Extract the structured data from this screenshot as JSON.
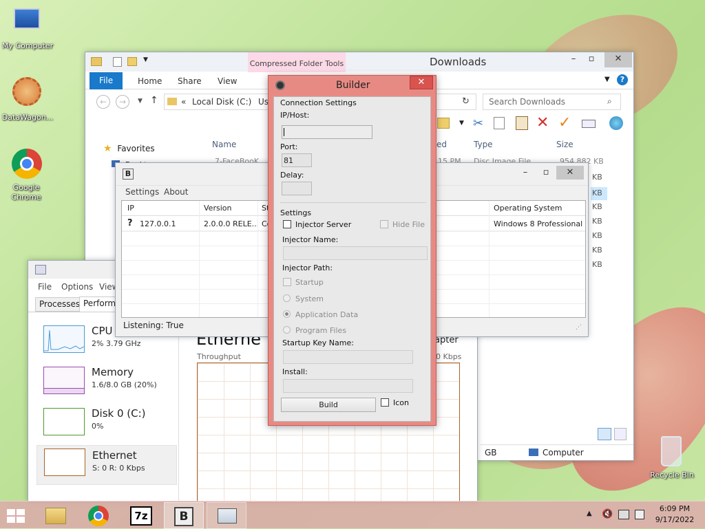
{
  "desktop": {
    "icons": [
      {
        "label": "My Computer"
      },
      {
        "label": "DataWagon..."
      },
      {
        "label": "Google Chrome"
      },
      {
        "label": "Recycle Bin"
      }
    ]
  },
  "explorer": {
    "title": "Downloads",
    "context_tab": "Compressed Folder Tools",
    "ribbon_tabs": [
      "File",
      "Home",
      "Share",
      "View"
    ],
    "address_prefix": "«",
    "address": "Local Disk (C:)",
    "address_tail": "Us",
    "search_placeholder": "Search Downloads",
    "nav": {
      "favorites": "Favorites",
      "desktop": "Desktop"
    },
    "columns": {
      "name": "Name",
      "date_partial": "ed",
      "type": "Type",
      "size": "Size"
    },
    "row_first": {
      "name_partial": "7-FaceBooK",
      "date_partial": "15 PM",
      "type": "Disc Image File",
      "size": "954,882 KB"
    },
    "size_unit": "KB",
    "status_size": "GB",
    "status_location": "Computer"
  },
  "client": {
    "icon_letter": "B",
    "menu": [
      "Settings",
      "About"
    ],
    "columns": [
      "IP",
      "Version",
      "St",
      "Operating System"
    ],
    "rows": [
      {
        "ip": "127.0.0.1",
        "version": "2.0.0.0 RELE...",
        "status": "Co",
        "os": "Windows 8 Professional 6"
      }
    ],
    "status": "Listening: True"
  },
  "taskmgr": {
    "menu": [
      "File",
      "Options",
      "View"
    ],
    "tabs": [
      "Processes",
      "Performa"
    ],
    "items": [
      {
        "name": "CPU",
        "value": "2% 3.79 GHz"
      },
      {
        "name": "Memory",
        "value": "1.6/8.0 GB (20%)"
      },
      {
        "name": "Disk 0 (C:)",
        "value": "0%"
      },
      {
        "name": "Ethernet",
        "value": "S: 0 R: 0 Kbps"
      }
    ],
    "heading": "Etherne",
    "adapter_partial": "apter",
    "throughput_label": "Throughput",
    "throughput_value": "0 Kbps"
  },
  "builder": {
    "title": "Builder",
    "connection_section": "Connection Settings",
    "ip_label": "IP/Host:",
    "ip_value": "",
    "port_label": "Port:",
    "port_value": "81",
    "delay_label": "Delay:",
    "delay_value": "",
    "settings_section": "Settings",
    "injector_server_label": "Injector Server",
    "hide_file_label": "Hide File",
    "injector_name_label": "Injector Name:",
    "injector_path_label": "Injector Path:",
    "startup_label": "Startup",
    "system_label": "System",
    "appdata_label": "Application Data",
    "program_files_label": "Program Files",
    "startup_key_label": "Startup Key Name:",
    "install_label": "Install:",
    "build_button": "Build",
    "icon_label": "Icon"
  },
  "taskbar": {
    "time": "6:09 PM",
    "date": "9/17/2022",
    "apps": [
      "File Explorer",
      "Google Chrome",
      "7-Zip",
      "Client",
      "Task Manager"
    ],
    "sevenzip_label": "7z",
    "client_label": "B"
  }
}
